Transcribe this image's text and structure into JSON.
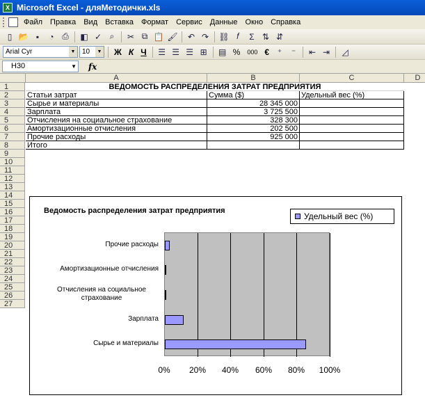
{
  "window": {
    "title": "Microsoft Excel - дляМетодички.xls"
  },
  "menu": {
    "items": [
      "Файл",
      "Правка",
      "Вид",
      "Вставка",
      "Формат",
      "Сервис",
      "Данные",
      "Окно",
      "Справка"
    ]
  },
  "format_toolbar": {
    "font_name": "Arial Cyr",
    "font_size": "10",
    "bold": "Ж",
    "italic": "К",
    "underline": "Ч",
    "percent": "%",
    "thousands": "000",
    "currency": "€"
  },
  "formula_bar": {
    "name_box": "H30",
    "fx": "fx",
    "formula": ""
  },
  "sheet": {
    "columns": [
      "A",
      "B",
      "C",
      "D"
    ],
    "rows": [
      "1",
      "2",
      "3",
      "4",
      "5",
      "6",
      "7",
      "8",
      "9",
      "10",
      "11",
      "12",
      "13",
      "14",
      "15",
      "16",
      "17",
      "18",
      "19",
      "20",
      "21",
      "22",
      "23",
      "24",
      "25",
      "26",
      "27"
    ],
    "title": "ВЕДОМОСТЬ РАСПРЕДЕЛЕНИЯ ЗАТРАТ ПРЕДПРИЯТИЯ",
    "headers": [
      "Статьи затрат",
      "Сумма ($)",
      "Удельный вес (%)"
    ],
    "data": [
      [
        "Сырье и материалы",
        "28 345 000",
        ""
      ],
      [
        "Зарплата",
        "3 725 500",
        ""
      ],
      [
        "Отчисления на социальное страхование",
        "328 300",
        ""
      ],
      [
        "Амортизационные отчисления",
        "202 500",
        ""
      ],
      [
        "Прочие расходы",
        "925 000",
        ""
      ],
      [
        "Итого",
        "",
        ""
      ]
    ]
  },
  "chart_data": {
    "type": "bar",
    "orientation": "horizontal",
    "title": "Ведомость распределения затрат предприятия",
    "categories": [
      "Прочие расходы",
      "Амортизационные отчисления",
      "Отчисления на социальное страхование",
      "Зарплата",
      "Сырье и материалы"
    ],
    "series": [
      {
        "name": "Удельный вес (%)",
        "values": [
          2.8,
          0.6,
          1.0,
          11.3,
          85.3
        ],
        "color": "#9999ff"
      }
    ],
    "xticks": [
      "0%",
      "20%",
      "40%",
      "60%",
      "80%",
      "100%"
    ],
    "xlim": [
      0,
      100
    ],
    "grid": true,
    "legend": "top-right",
    "plot_background": "#c0c0c0"
  }
}
